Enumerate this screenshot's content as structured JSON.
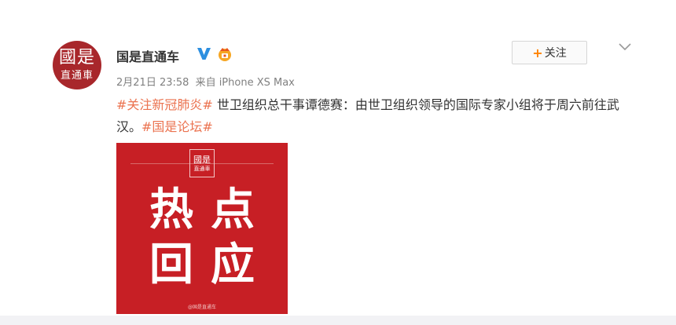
{
  "account": {
    "name": "国是直通车",
    "avatar_line1": "國是",
    "avatar_line2": "直通車",
    "verified_icon": "verified-v-icon",
    "badge_icon": "member-badge-icon"
  },
  "actions": {
    "follow_plus": "+",
    "follow_label": "关注",
    "more_icon": "chevron-down-icon"
  },
  "post": {
    "date": "2月21日 23:58",
    "source": "来自 iPhone XS Max",
    "hashtag1": "#关注新冠肺炎#",
    "text": " 世卫组织总干事谭德赛：由世卫组织领导的国际专家小组将于周六前往武汉。",
    "hashtag2": "#国是论坛#",
    "image": {
      "logo_line1": "國是",
      "logo_line2": "直通車",
      "headline_line1": "热点",
      "headline_line2": "回应",
      "caption": "@国是直通车"
    }
  },
  "colors": {
    "accent": "#eb7350",
    "image_bg": "#c71f25",
    "avatar_bg": "#a8272b",
    "verified": "#2c8fe0"
  }
}
